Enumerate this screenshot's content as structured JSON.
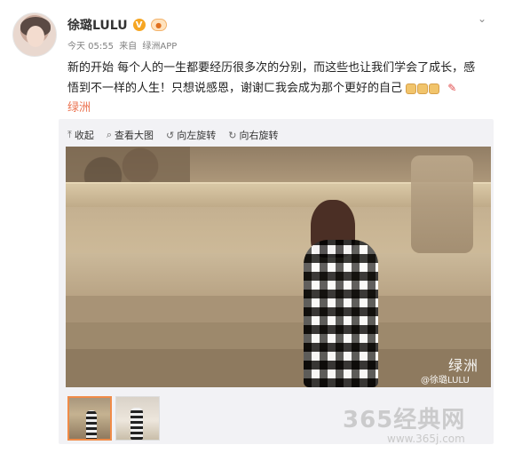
{
  "user": {
    "name": "徐璐LULU",
    "verified_label": "V"
  },
  "meta": {
    "time": "今天 05:55",
    "source_prefix": "来自",
    "source": "绿洲APP"
  },
  "post": {
    "text": "新的开始 每个人的一生都要经历很多次的分别，而这些也让我们学会了成长，感悟到不一样的人生！只想说感恩，谢谢ㄈ我会成为那个更好的自己",
    "tag": "绿洲"
  },
  "toolbar": {
    "collapse": "收起",
    "view_large": "查看大图",
    "rotate_left": "向左旋转",
    "rotate_right": "向右旋转"
  },
  "photo": {
    "brand_mark": "绿洲",
    "user_mark": "@徐璐LULU"
  },
  "site": {
    "watermark": "365经典网",
    "url": "www.365j.com"
  },
  "icons": [
    "chevron-down-icon",
    "verified-badge-icon",
    "member-badge-icon",
    "collapse-icon",
    "search-icon",
    "rotate-left-icon",
    "rotate-right-icon",
    "pen-icon"
  ],
  "colors": {
    "accent": "#eb7350",
    "verified": "#f6a623",
    "selected_thumb": "#f08b48"
  }
}
